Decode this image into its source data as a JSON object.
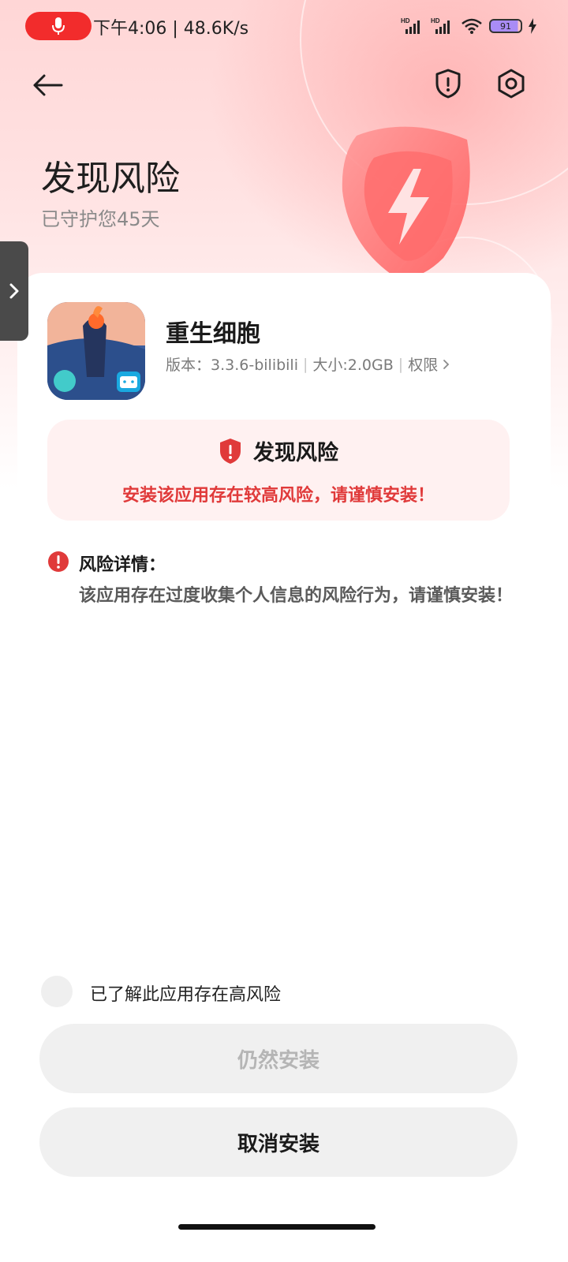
{
  "status_bar": {
    "time_speed": "下午4:06 | 48.6K/s",
    "battery_level": "91",
    "signal_badge": "HD"
  },
  "hero": {
    "title": "发现风险",
    "subtitle": "已守护您45天"
  },
  "app": {
    "name": "重生细胞",
    "version": "版本：3.3.6-bilibili",
    "size": "大小:2.0GB",
    "permissions_label": "权限"
  },
  "risk_banner": {
    "title": "发现风险",
    "description": "安装该应用存在较高风险，请谨慎安装！"
  },
  "risk_detail": {
    "title": "风险详情：",
    "text": "该应用存在过度收集个人信息的风险行为，请谨慎安装！"
  },
  "acknowledge": {
    "label": "已了解此应用存在高风险",
    "checked": false
  },
  "buttons": {
    "install_anyway": "仍然安装",
    "cancel_install": "取消安装"
  },
  "colors": {
    "accent_red": "#e03a3a",
    "mic_pill": "#f22c2c",
    "risk_box_bg": "#fff1f1",
    "button_bg": "#f0f0f0"
  }
}
